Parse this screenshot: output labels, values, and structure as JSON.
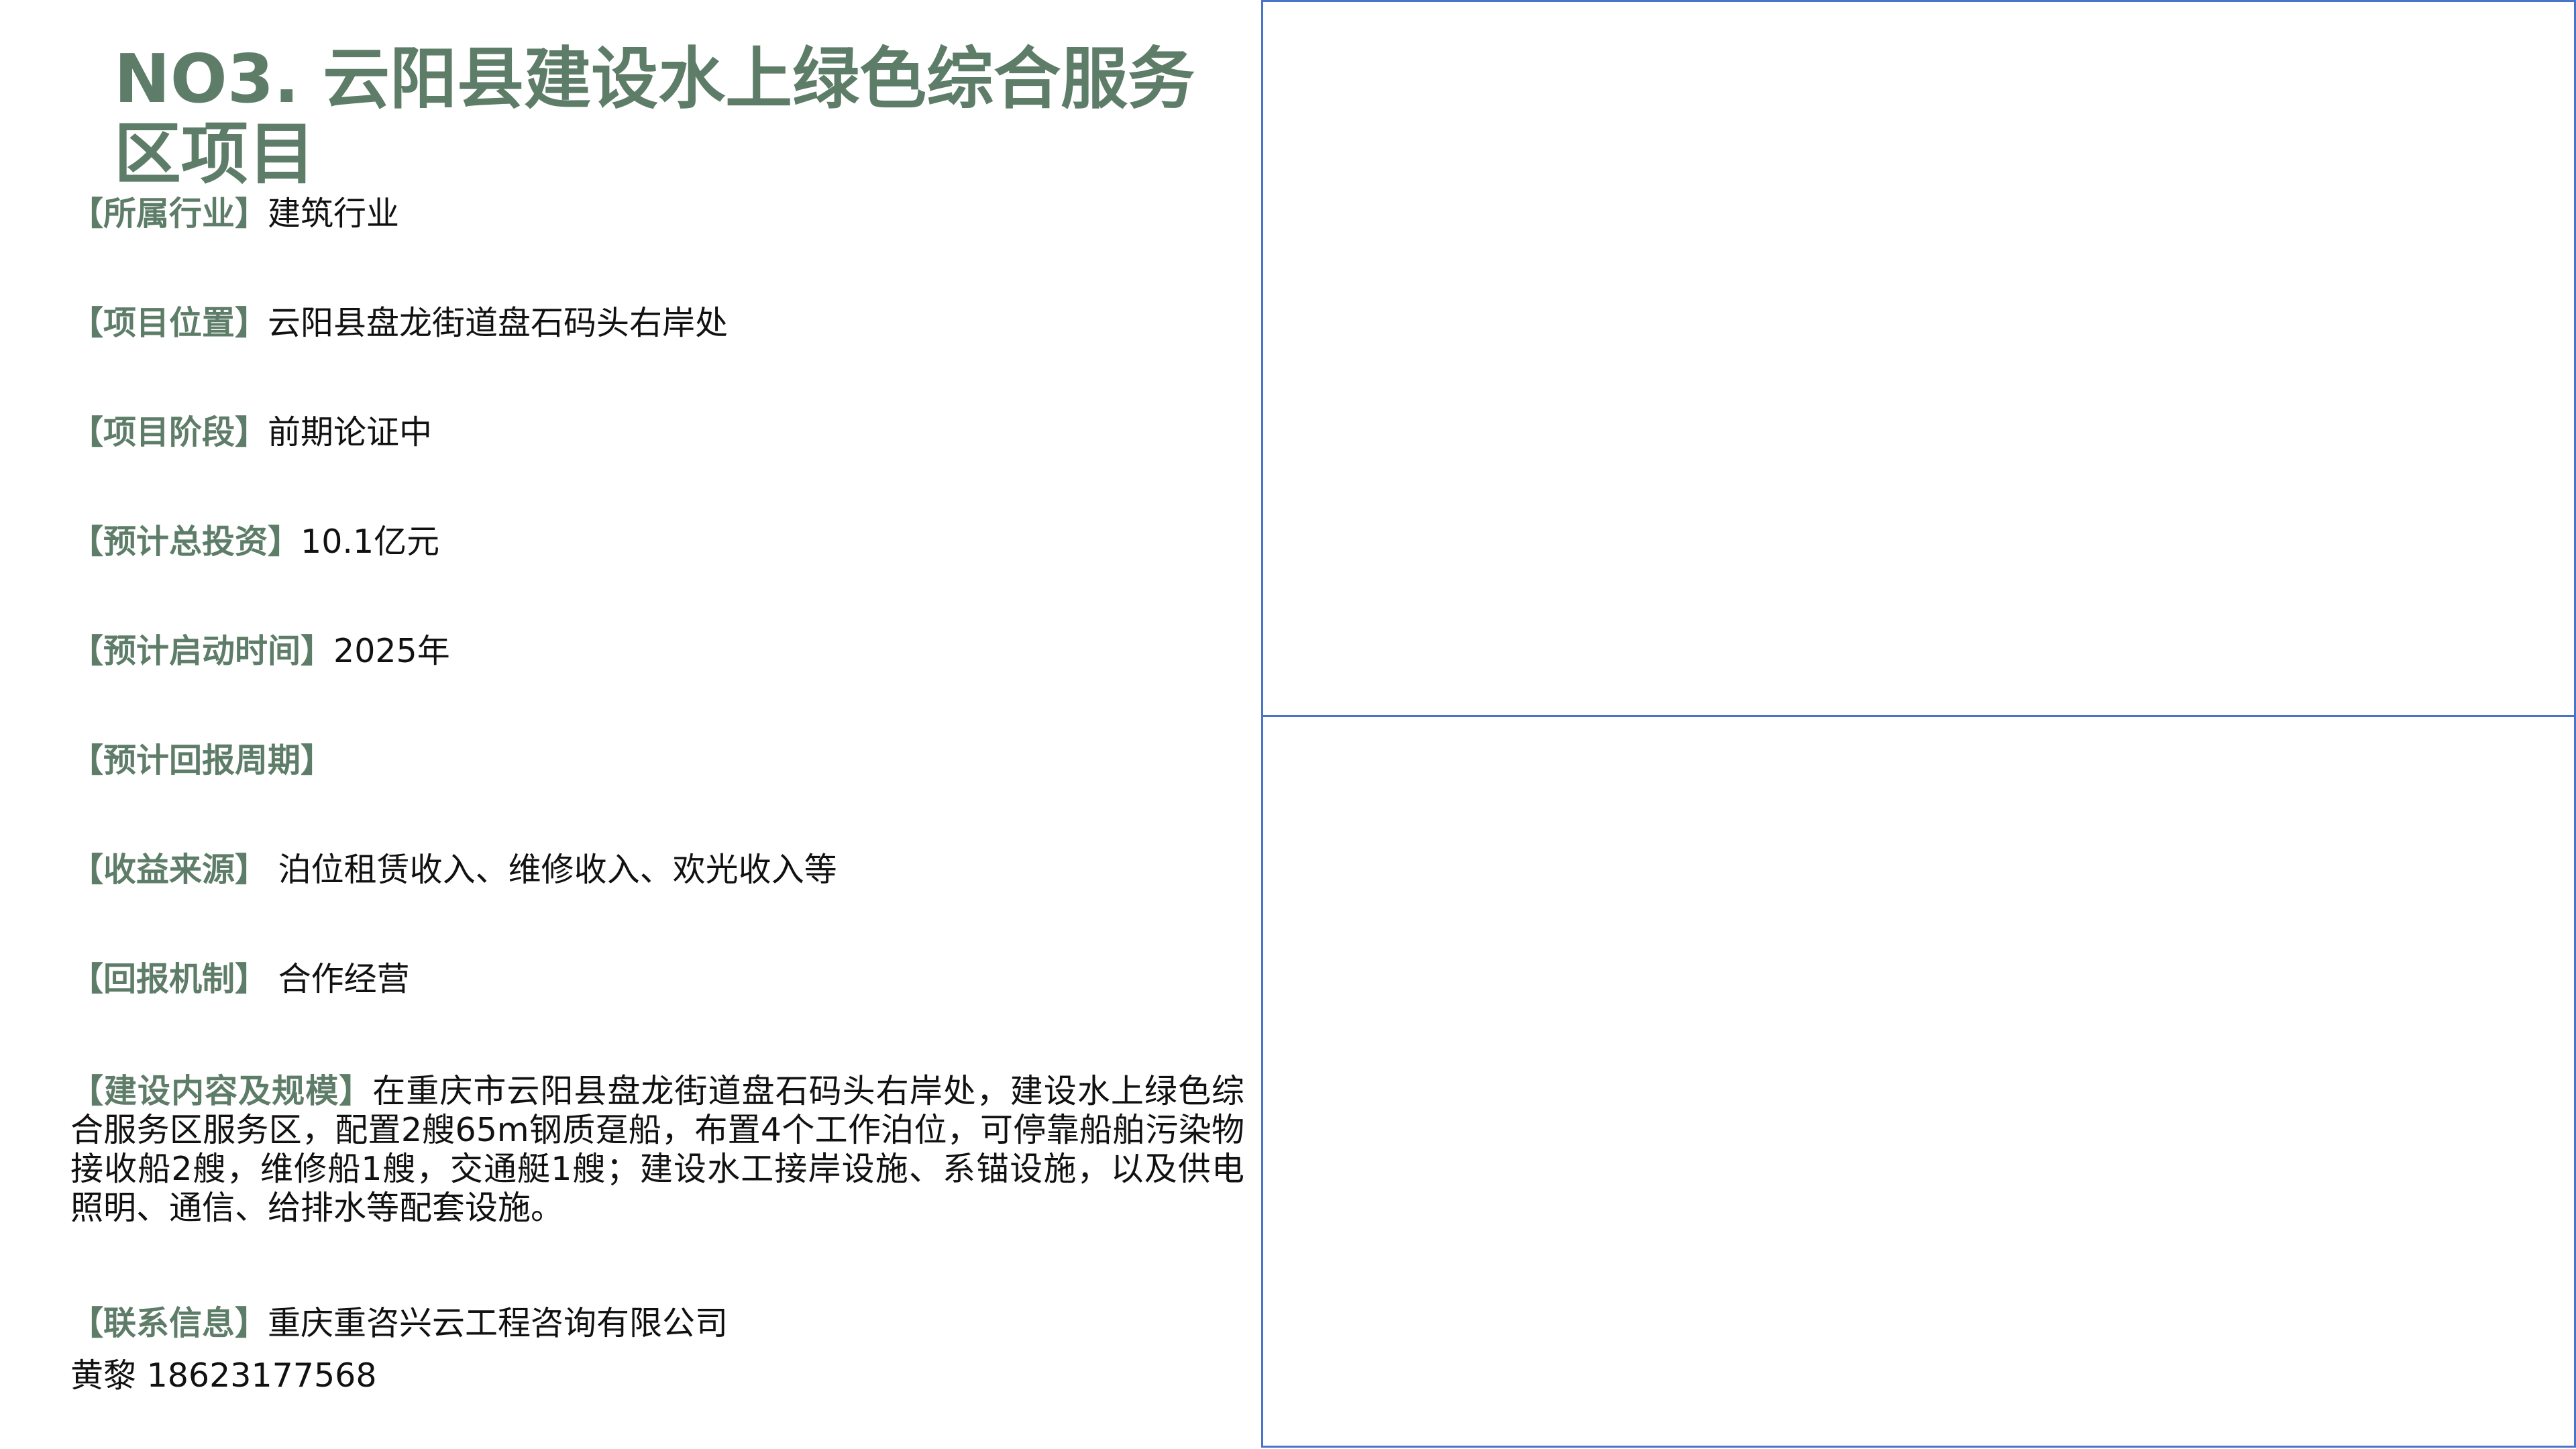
{
  "title": "NO3. 云阳县建设水上绿色综合服务区项目",
  "fields": {
    "industry": {
      "label": "【所属行业】",
      "value": "建筑行业"
    },
    "location": {
      "label": "【项目位置】",
      "value": "云阳县盘龙街道盘石码头右岸处"
    },
    "stage": {
      "label": "【项目阶段】",
      "value": "前期论证中"
    },
    "investment": {
      "label": "【预计总投资】",
      "value": "10.1亿元"
    },
    "start_time": {
      "label": "【预计启动时间】",
      "value": "2025年"
    },
    "payback_period": {
      "label": "【预计回报周期】",
      "value": ""
    },
    "revenue_source": {
      "label": "【收益来源】",
      "value": " 泊位租赁收入、维修收入、欢光收入等"
    },
    "return_mechanism": {
      "label": "【回报机制】",
      "value": " 合作经营"
    },
    "content_scale": {
      "label": "【建设内容及规模】",
      "value": "在重庆市云阳县盘龙街道盘石码头右岸处，建设水上绿色综合服务区服务区，配置2艘65m钢质趸船，布置4个工作泊位，可停靠船舶污染物接收船2艘，维修船1艘，交通艇1艘；建设水工接岸设施、系锚设施，以及供电照明、通信、给排水等配套设施。"
    },
    "contact": {
      "label": "【联系信息】",
      "value": "重庆重咨兴云工程咨询有限公司"
    }
  },
  "contact_person": "黄黎 18623177568",
  "colors": {
    "heading_green": "#5e7d68",
    "frame_blue": "#4a74c9",
    "text": "#111111"
  }
}
